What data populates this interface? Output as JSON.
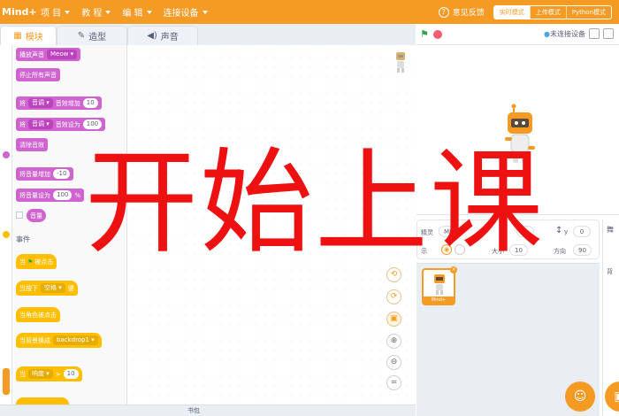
{
  "topbar": {
    "logo": "Mind+",
    "menu": [
      {
        "label": "项 目"
      },
      {
        "label": "教 程"
      },
      {
        "label": "编 辑"
      },
      {
        "label": "连接设备"
      }
    ],
    "feedback": "意见反馈",
    "modes": [
      "实时模式",
      "上传模式",
      "Python模式"
    ]
  },
  "tabs": [
    {
      "label": "模块",
      "icon": "puzzle-icon"
    },
    {
      "label": "造型",
      "icon": "brush-icon"
    },
    {
      "label": "声音",
      "icon": "speaker-icon"
    }
  ],
  "palette": {
    "sound": {
      "play_sound": "播放声音",
      "play_sound_value": "Meow",
      "stop_all_sounds": "停止所有声音",
      "change_effect_prefix": "将",
      "change_effect_option": "音调",
      "change_effect_label": "音效增加",
      "change_effect_value": "10",
      "set_effect_prefix": "将",
      "set_effect_option": "音调",
      "set_effect_label": "音效设为",
      "set_effect_value": "100",
      "clear_effects": "清除音效",
      "change_volume_label": "将音量增加",
      "change_volume_value": "-10",
      "set_volume_label": "将音量设为",
      "set_volume_value": "100",
      "set_volume_unit": "%",
      "volume_reporter": "音量"
    },
    "events": {
      "section_title": "事件",
      "when_flag_prefix": "当",
      "when_flag_suffix": "被点击",
      "when_key_prefix": "当按下",
      "when_key_value": "空格",
      "when_key_suffix": "键",
      "when_sprite_clicked": "当角色被点击",
      "when_backdrop_label": "当背景换成",
      "when_backdrop_value": "backdrop1",
      "when_greater_prefix": "当",
      "when_greater_option": "响度",
      "when_greater_op": ">",
      "when_greater_value": "10"
    }
  },
  "bottom": {
    "backpack": "书包"
  },
  "stage_header": {
    "connection": "未连接设备"
  },
  "sprite_info": {
    "sprite_label": "精灵",
    "sprite_name": "Min",
    "x_value": "0",
    "y_label": "y",
    "y_value": "0",
    "show_label": "示",
    "size_label": "大小",
    "size_value": "10",
    "direction_label": "方向",
    "direction_value": "90"
  },
  "sprite_list": [
    {
      "name": "Mind+"
    }
  ],
  "stage_pane": {
    "label": "舞",
    "sub": "背"
  },
  "overlay_text": "开始上课",
  "colors": {
    "accent": "#f59a23",
    "sound": "#cf63cf",
    "events": "#ffbf00",
    "overlay": "#ee1111"
  }
}
